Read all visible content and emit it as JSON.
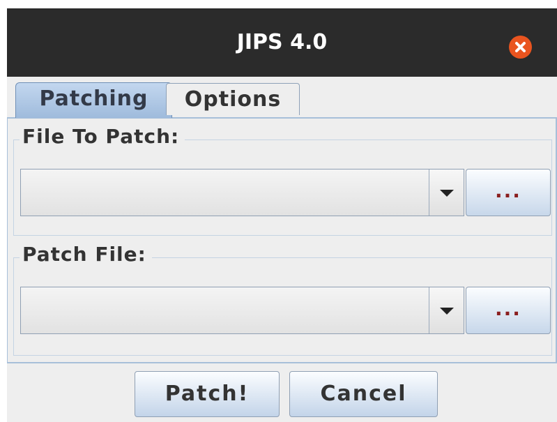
{
  "window": {
    "title": "JIPS 4.0"
  },
  "tabs": [
    {
      "label": "Patching",
      "active": true
    },
    {
      "label": "Options",
      "active": false
    }
  ],
  "file_to_patch": {
    "legend": "File To Patch:",
    "value": "",
    "browse_label": "..."
  },
  "patch_file": {
    "legend": "Patch File:",
    "value": "",
    "browse_label": "..."
  },
  "buttons": {
    "patch": "Patch!",
    "cancel": "Cancel"
  },
  "colors": {
    "titlebar": "#2b2b2b",
    "close_button": "#e9541f",
    "active_tab": "#b1c9e6",
    "window_bg": "#eeeeee"
  },
  "icons": {
    "close": "close-icon",
    "dropdown": "chevron-down-icon"
  }
}
